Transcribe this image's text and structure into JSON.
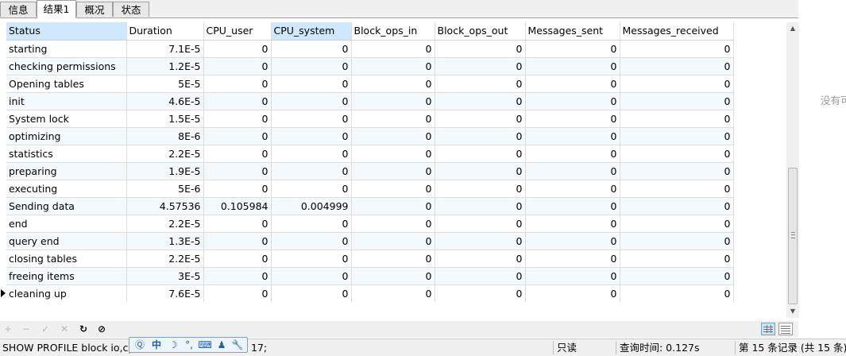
{
  "tabs": [
    {
      "label": "信息",
      "active": false
    },
    {
      "label": "结果1",
      "active": true
    },
    {
      "label": "概况",
      "active": false
    },
    {
      "label": "状态",
      "active": false
    }
  ],
  "columns": [
    "Status",
    "Duration",
    "CPU_user",
    "CPU_system",
    "Block_ops_in",
    "Block_ops_out",
    "Messages_sent",
    "Messages_received"
  ],
  "selected_columns": [
    "Status",
    "CPU_system"
  ],
  "rows": [
    [
      "starting",
      "7.1E-5",
      "0",
      "0",
      "0",
      "0",
      "0",
      "0"
    ],
    [
      "checking permissions",
      "1.2E-5",
      "0",
      "0",
      "0",
      "0",
      "0",
      "0"
    ],
    [
      "Opening tables",
      "5E-5",
      "0",
      "0",
      "0",
      "0",
      "0",
      "0"
    ],
    [
      "init",
      "4.6E-5",
      "0",
      "0",
      "0",
      "0",
      "0",
      "0"
    ],
    [
      "System lock",
      "1.5E-5",
      "0",
      "0",
      "0",
      "0",
      "0",
      "0"
    ],
    [
      "optimizing",
      "8E-6",
      "0",
      "0",
      "0",
      "0",
      "0",
      "0"
    ],
    [
      "statistics",
      "2.2E-5",
      "0",
      "0",
      "0",
      "0",
      "0",
      "0"
    ],
    [
      "preparing",
      "1.9E-5",
      "0",
      "0",
      "0",
      "0",
      "0",
      "0"
    ],
    [
      "executing",
      "5E-6",
      "0",
      "0",
      "0",
      "0",
      "0",
      "0"
    ],
    [
      "Sending data",
      "4.57536",
      "0.105984",
      "0.004999",
      "0",
      "0",
      "0",
      "0"
    ],
    [
      "end",
      "2.2E-5",
      "0",
      "0",
      "0",
      "0",
      "0",
      "0"
    ],
    [
      "query end",
      "1.3E-5",
      "0",
      "0",
      "0",
      "0",
      "0",
      "0"
    ],
    [
      "closing tables",
      "2.2E-5",
      "0",
      "0",
      "0",
      "0",
      "0",
      "0"
    ],
    [
      "freeing items",
      "3E-5",
      "0",
      "0",
      "0",
      "0",
      "0",
      "0"
    ],
    [
      "cleaning up",
      "7.6E-5",
      "0",
      "0",
      "0",
      "0",
      "0",
      "0"
    ]
  ],
  "current_row": 14,
  "side_pane_text": "没有可",
  "toolbar": {
    "add": "+",
    "remove": "−",
    "apply": "✓",
    "discard": "✕",
    "refresh": "↻",
    "stop": "⊘"
  },
  "status": {
    "sql_left": "SHOW PROFILE block io,cp",
    "sql_right": "17;",
    "mode": "只读",
    "query_time": "查询时间: 0.127s",
    "records": "第 15 条记录 (共 15 条)"
  },
  "ime": [
    "Ⓠ",
    "中",
    "☽",
    "°,",
    "⌨",
    "♟",
    "🔧"
  ],
  "colors": {
    "header_selected": "#cfe8fb",
    "alt_row": "#f4f9fd",
    "ime_border": "#7aa3d0"
  },
  "icons": {
    "row_pointer": "triangle-right-icon",
    "grid_view": "grid-view-icon",
    "form_view": "form-view-icon"
  }
}
